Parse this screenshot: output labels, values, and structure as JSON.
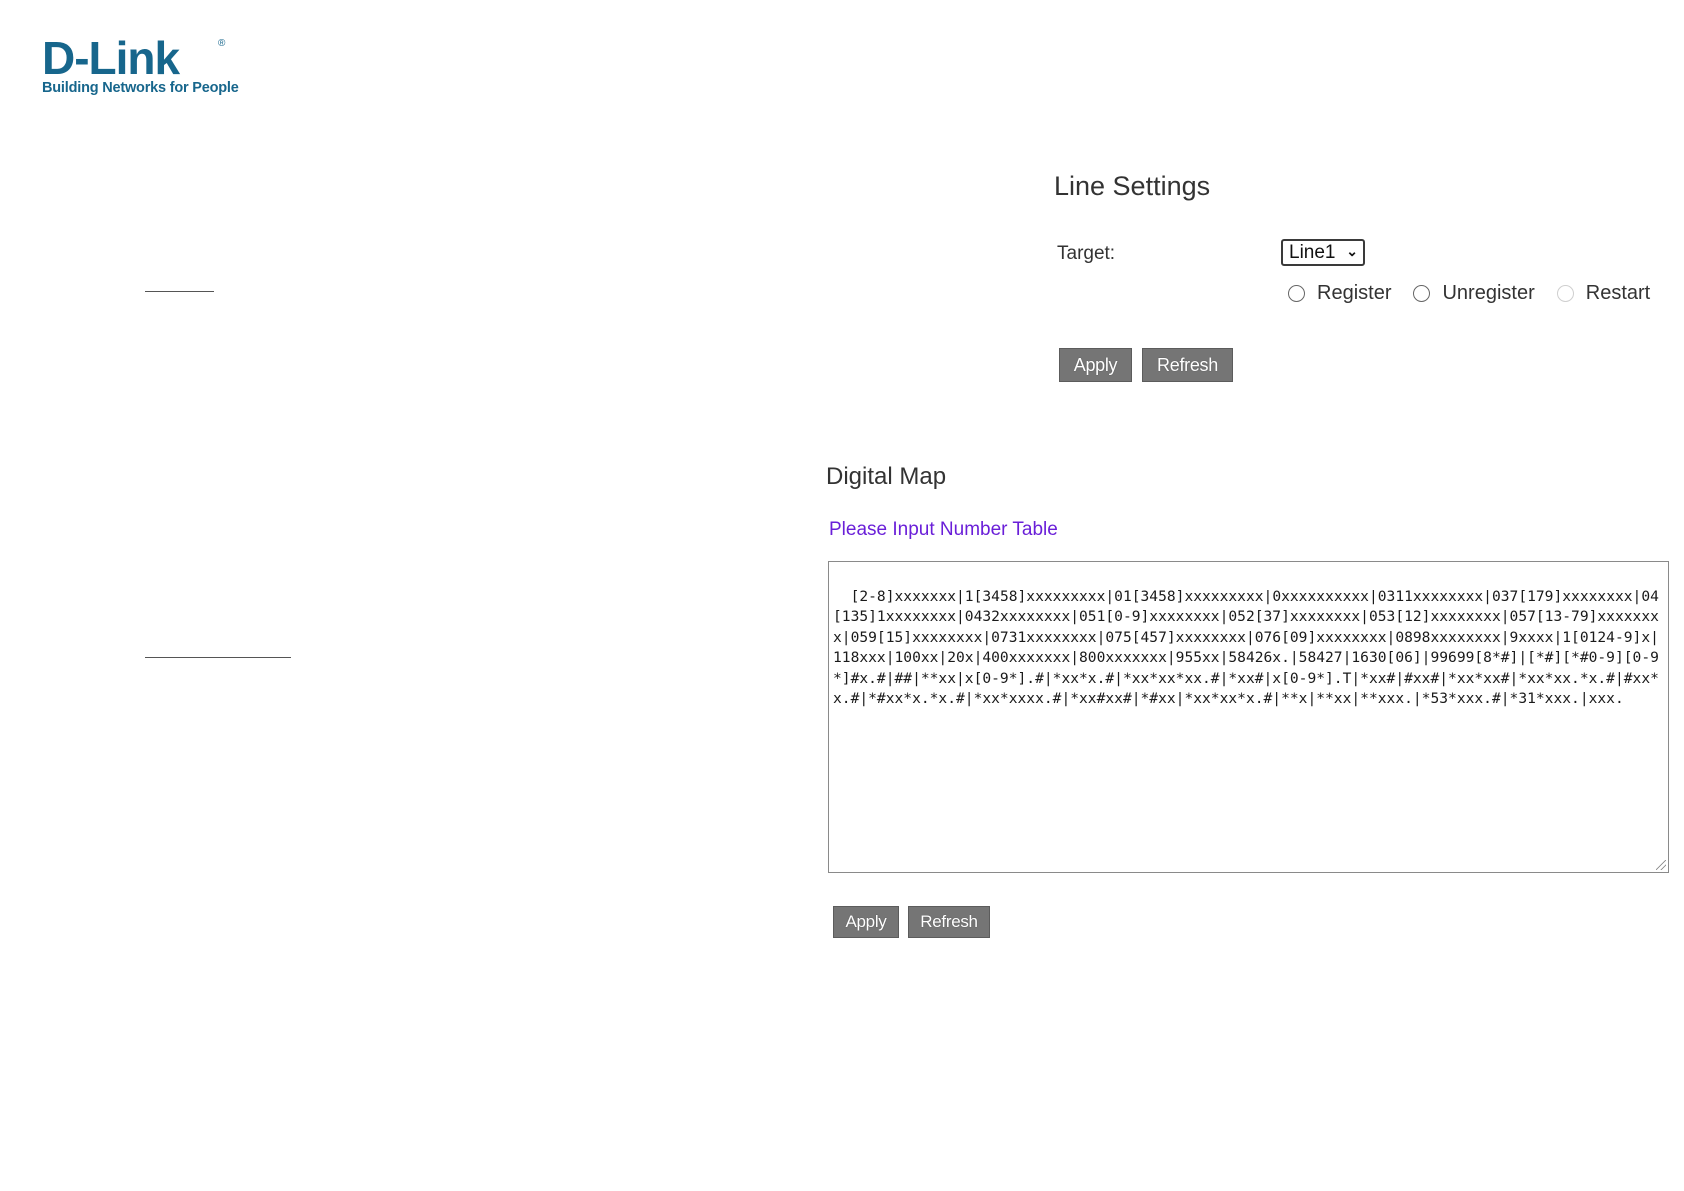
{
  "logo": {
    "word": "D-Link",
    "registered": "®",
    "tagline": "Building Networks for People"
  },
  "line_settings": {
    "title": "Line Settings",
    "target_label": "Target:",
    "target_value": "Line1",
    "radios": [
      {
        "label": "Register"
      },
      {
        "label": "Unregister"
      },
      {
        "label": "Restart"
      }
    ],
    "apply_label": "Apply",
    "refresh_label": "Refresh"
  },
  "digital_map": {
    "title": "Digital Map",
    "hint": "Please Input Number Table",
    "value": "[2-8]xxxxxxx|1[3458]xxxxxxxxx|01[3458]xxxxxxxxx|0xxxxxxxxxx|0311xxxxxxxx|037[179]xxxxxxxx|04[135]1xxxxxxxx|0432xxxxxxxx|051[0-9]xxxxxxxx|052[37]xxxxxxxx|053[12]xxxxxxxx|057[13-79]xxxxxxxx|059[15]xxxxxxxx|0731xxxxxxxx|075[457]xxxxxxxx|076[09]xxxxxxxx|0898xxxxxxxx|9xxxx|1[0124-9]x|118xxx|100xx|20x|400xxxxxxx|800xxxxxxx|955xx|58426x.|58427|1630[06]|99699[8*#]|[*#][*#0-9][0-9*]#x.#|##|**xx|x[0-9*].#|*xx*x.#|*xx*xx*xx.#|*xx#|x[0-9*].T|*xx#|#xx#|*xx*xx#|*xx*xx.*x.#|#xx*x.#|*#xx*x.*x.#|*xx*xxxx.#|*xx#xx#|*#xx|*xx*xx*x.#|**x|**xx|**xxx.|*53*xxx.#|*31*xxx.|xxx.",
    "apply_label": "Apply",
    "refresh_label": "Refresh"
  }
}
